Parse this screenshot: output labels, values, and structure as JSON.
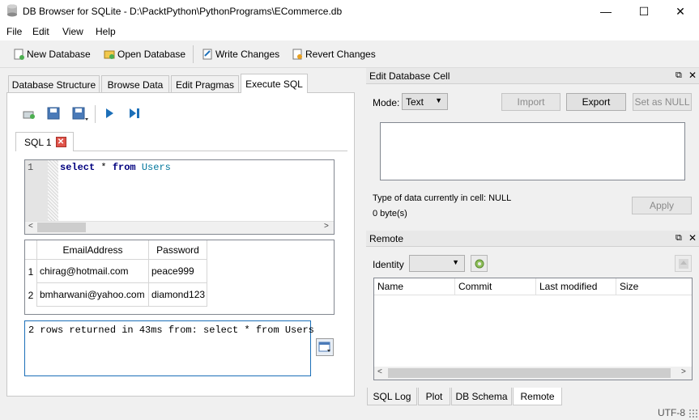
{
  "window": {
    "title": "DB Browser for SQLite - D:\\PacktPython\\PythonPrograms\\ECommerce.db",
    "minimize": "—",
    "maximize": "☐",
    "close": "✕"
  },
  "menu": [
    "File",
    "Edit",
    "View",
    "Help"
  ],
  "toolbar": {
    "new_db": "New Database",
    "open_db": "Open Database",
    "write": "Write Changes",
    "revert": "Revert Changes"
  },
  "tabs": [
    "Database Structure",
    "Browse Data",
    "Edit Pragmas",
    "Execute SQL"
  ],
  "editor": {
    "tab_label": "SQL 1",
    "line_number": "1",
    "kw_select": "select",
    "star": "*",
    "kw_from": "from",
    "table_name": "Users"
  },
  "results": {
    "columns": [
      "EmailAddress",
      "Password"
    ],
    "rows": [
      {
        "num": "1",
        "email": "chirag@hotmail.com",
        "password": "peace999"
      },
      {
        "num": "2",
        "email": "bmharwani@yahoo.com",
        "password": "diamond123"
      }
    ]
  },
  "message": "2 rows returned in 43ms from: select * from Users",
  "edit_cell": {
    "title": "Edit Database Cell",
    "mode_label": "Mode:",
    "mode_value": "Text",
    "import": "Import",
    "export": "Export",
    "set_null": "Set as NULL",
    "type_info": "Type of data currently in cell: NULL",
    "size_info": "0 byte(s)",
    "apply": "Apply"
  },
  "remote": {
    "title": "Remote",
    "identity_label": "Identity",
    "columns": [
      "Name",
      "Commit",
      "Last modified",
      "Size"
    ]
  },
  "bottom_tabs": [
    "SQL Log",
    "Plot",
    "DB Schema",
    "Remote"
  ],
  "status": {
    "encoding": "UTF-8"
  },
  "colors": {
    "keyword": "#00007f",
    "identifier": "#00769c",
    "accent": "#1c6fb8"
  }
}
